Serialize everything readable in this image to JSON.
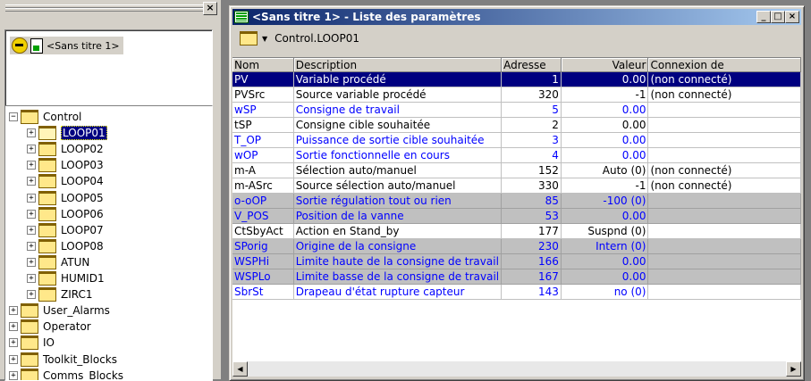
{
  "left_pane": {
    "close_glyph": "×",
    "document_label": "<Sans titre 1>",
    "tree": [
      {
        "label": "Control",
        "expander": "−",
        "level": 0
      },
      {
        "label": "LOOP01",
        "expander": "+",
        "level": 1,
        "selected": true
      },
      {
        "label": "LOOP02",
        "expander": "+",
        "level": 1
      },
      {
        "label": "LOOP03",
        "expander": "+",
        "level": 1
      },
      {
        "label": "LOOP04",
        "expander": "+",
        "level": 1
      },
      {
        "label": "LOOP05",
        "expander": "+",
        "level": 1
      },
      {
        "label": "LOOP06",
        "expander": "+",
        "level": 1
      },
      {
        "label": "LOOP07",
        "expander": "+",
        "level": 1
      },
      {
        "label": "LOOP08",
        "expander": "+",
        "level": 1
      },
      {
        "label": "ATUN",
        "expander": "+",
        "level": 1
      },
      {
        "label": "HUMID1",
        "expander": "+",
        "level": 1
      },
      {
        "label": "ZIRC1",
        "expander": "+",
        "level": 1
      },
      {
        "label": "User_Alarms",
        "expander": "+",
        "level": 0
      },
      {
        "label": "Operator",
        "expander": "+",
        "level": 0
      },
      {
        "label": "IO",
        "expander": "+",
        "level": 0
      },
      {
        "label": "Toolkit_Blocks",
        "expander": "+",
        "level": 0
      },
      {
        "label": "Comms_Blocks",
        "expander": "+",
        "level": 0
      }
    ]
  },
  "window": {
    "title": "<Sans titre 1> - Liste des paramètres",
    "minimize_glyph": "_",
    "maximize_glyph": "□",
    "close_glyph": "×",
    "path": "Control.LOOP01",
    "columns": [
      "Nom",
      "Description",
      "Adresse",
      "Valeur",
      "Connexion de"
    ],
    "rows": [
      {
        "nom": "PV",
        "description": "Variable procédé",
        "adresse": "1",
        "valeur": "0.00",
        "connexion": "(non connecté)",
        "style": "sel"
      },
      {
        "nom": "PVSrc",
        "description": "Source variable procédé",
        "adresse": "320",
        "valeur": "-1",
        "connexion": "(non connecté)",
        "style": ""
      },
      {
        "nom": "wSP",
        "description": "Consigne de travail",
        "adresse": "5",
        "valeur": "0.00",
        "connexion": "",
        "style": "blue"
      },
      {
        "nom": "tSP",
        "description": "Consigne cible souhaitée",
        "adresse": "2",
        "valeur": "0.00",
        "connexion": "",
        "style": ""
      },
      {
        "nom": "T_OP",
        "description": "Puissance de sortie cible souhaitée",
        "adresse": "3",
        "valeur": "0.00",
        "connexion": "",
        "style": "blue"
      },
      {
        "nom": "wOP",
        "description": "Sortie fonctionnelle en cours",
        "adresse": "4",
        "valeur": "0.00",
        "connexion": "",
        "style": "blue"
      },
      {
        "nom": "m-A",
        "description": "Sélection auto/manuel",
        "adresse": "152",
        "valeur": "Auto (0)",
        "connexion": "(non connecté)",
        "style": ""
      },
      {
        "nom": "m-ASrc",
        "description": "Source sélection auto/manuel",
        "adresse": "330",
        "valeur": "-1",
        "connexion": "(non connecté)",
        "style": ""
      },
      {
        "nom": "o-oOP",
        "description": "Sortie régulation tout ou rien",
        "adresse": "85",
        "valeur": "-100 (0)",
        "connexion": "",
        "style": "blue gray"
      },
      {
        "nom": "V_POS",
        "description": "Position de la vanne",
        "adresse": "53",
        "valeur": "0.00",
        "connexion": "",
        "style": "blue gray"
      },
      {
        "nom": "CtSbyAct",
        "description": "Action en Stand_by",
        "adresse": "177",
        "valeur": "Suspnd (0)",
        "connexion": "",
        "style": ""
      },
      {
        "nom": "SPorig",
        "description": "Origine de la consigne",
        "adresse": "230",
        "valeur": "Intern (0)",
        "connexion": "",
        "style": "blue gray"
      },
      {
        "nom": "WSPHi",
        "description": "Limite haute de la consigne de travail",
        "adresse": "166",
        "valeur": "0.00",
        "connexion": "",
        "style": "blue gray"
      },
      {
        "nom": "WSPLo",
        "description": "Limite basse de la consigne de travail",
        "adresse": "167",
        "valeur": "0.00",
        "connexion": "",
        "style": "blue gray"
      },
      {
        "nom": "SbrSt",
        "description": "Drapeau d'état rupture capteur",
        "adresse": "143",
        "valeur": "no (0)",
        "connexion": "",
        "style": "blue"
      }
    ]
  },
  "scrollbar": {
    "left_glyph": "◀",
    "right_glyph": "▶"
  }
}
